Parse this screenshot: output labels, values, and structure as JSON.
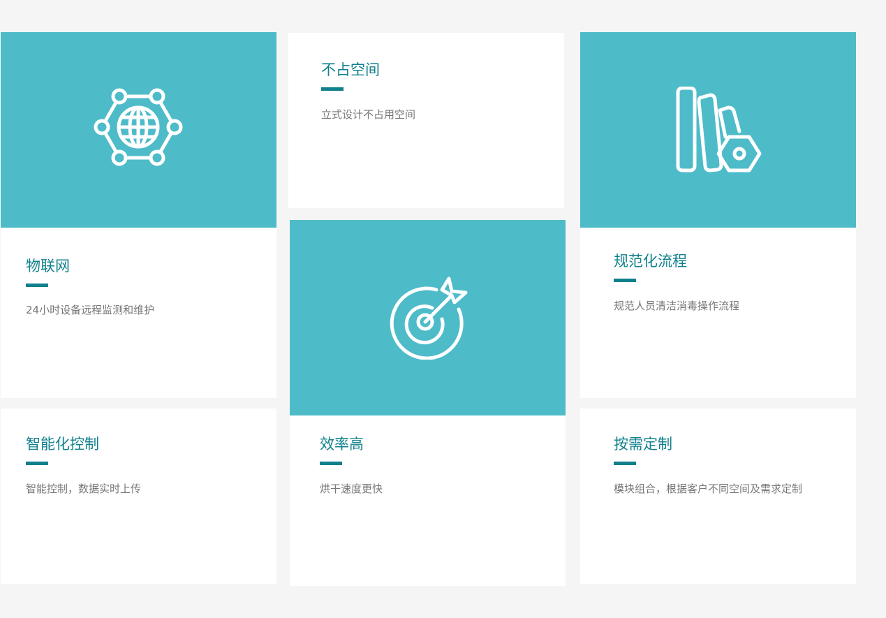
{
  "colors": {
    "page_bg": "#f5f5f5",
    "card_bg": "#ffffff",
    "accent_teal": "#4ebbc9",
    "title_teal": "#10808c",
    "desc_gray": "#777777"
  },
  "features": {
    "iot": {
      "icon": "network-globe-icon",
      "title": "物联网",
      "desc": "24小时设备远程监测和维护"
    },
    "space": {
      "title": "不占空间",
      "desc": "立式设计不占用空间"
    },
    "process": {
      "icon": "books-pen-icon",
      "title": "规范化流程",
      "desc": "规范人员清洁消毒操作流程"
    },
    "smart": {
      "title": "智能化控制",
      "desc": "智能控制，数据实时上传"
    },
    "efficiency": {
      "icon": "target-arrow-icon",
      "title": "效率高",
      "desc": "烘干速度更快"
    },
    "custom": {
      "title": "按需定制",
      "desc": "模块组合，根据客户不同空间及需求定制"
    }
  }
}
